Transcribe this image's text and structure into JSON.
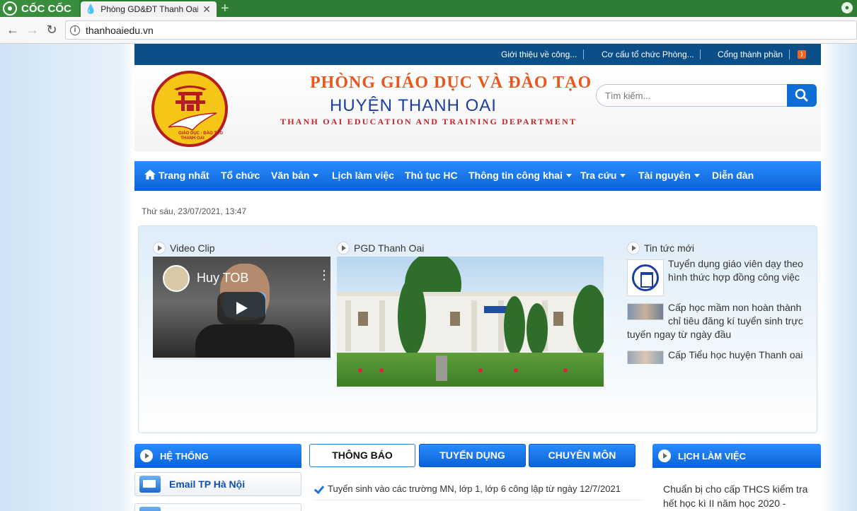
{
  "browser": {
    "brand": "CỐC CỐC",
    "tab_title": "Phòng GD&ĐT Thanh Oai",
    "url": "thanhoaiedu.vn"
  },
  "topbar": {
    "links": [
      "Giới thiệu về công...",
      "Cơ cấu tổ chức Phòng...",
      "Cổng thành phần"
    ]
  },
  "header": {
    "line1": "PHÒNG GIÁO DỤC VÀ ĐÀO TẠO",
    "line2": "HUYỆN THANH OAI",
    "line3": "THANH OAI EDUCATION AND TRAINING DEPARTMENT",
    "seal_text_1": "GIÁO DỤC - ĐÀO TẠO",
    "seal_text_2": "THANH OAI",
    "search_placeholder": "Tìm kiếm..."
  },
  "menu": {
    "items": [
      "Trang nhất",
      "Tổ chức",
      "Văn bản",
      "Lịch làm việc",
      "Thủ tục HC",
      "Thông tin công khai",
      "Tra cứu",
      "Tài nguyên",
      "Diễn đàn"
    ]
  },
  "datetime": "Thứ sáu, 23/07/2021, 13:47",
  "showcase": {
    "video_heading": "Video Clip",
    "video_channel": "Huy TOB",
    "photo_heading": "PGD Thanh Oai",
    "news_heading": "Tin tức mới",
    "news": [
      "Tuyển dụng giáo viên dạy theo hình thức hợp đồng công việc",
      "Cấp học mầm non hoàn thành chỉ tiêu đăng kí tuyển sinh trực tuyến ngay từ ngày đầu",
      "Cấp Tiểu học huyện Thanh oai"
    ]
  },
  "left_box": {
    "title": "HỆ THỐNG",
    "links": [
      "Email TP Hà Nội"
    ]
  },
  "center_tabs": {
    "tabs": [
      "THÔNG BÁO",
      "TUYỂN DỤNG",
      "CHUYÊN MÔN"
    ],
    "notice": "Tuyển sinh vào các trường MN, lớp 1, lớp 6 công lập từ ngày 12/7/2021"
  },
  "right_box": {
    "title": "LỊCH LÀM VIỆC",
    "text": "Chuẩn bị cho cấp THCS kiểm tra hết học kì II năm học 2020 -"
  },
  "colors": {
    "primary_blue": "#0a63d6",
    "dark_blue": "#0b4f8a",
    "title_orange": "#e8571e",
    "title_navy": "#1c3f9e",
    "title_red": "#c1272d",
    "browser_green": "#2e7d32"
  }
}
